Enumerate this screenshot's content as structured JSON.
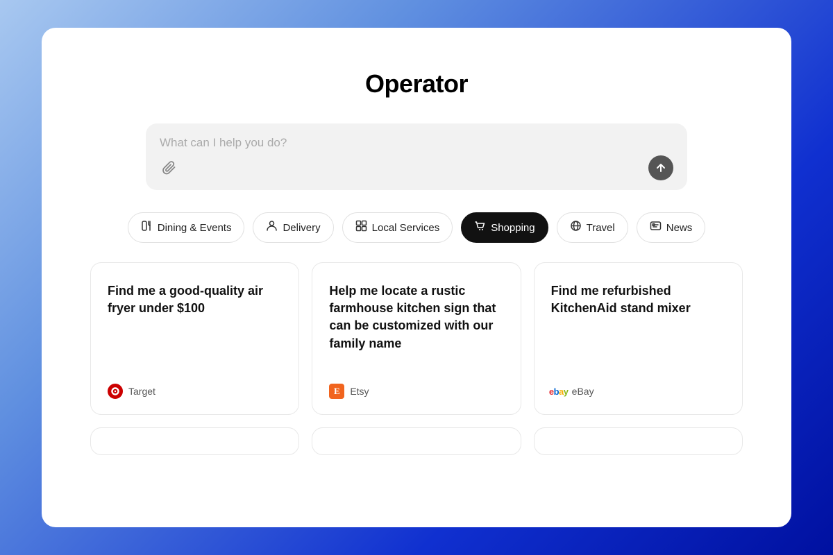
{
  "app": {
    "title": "Operator"
  },
  "search": {
    "placeholder": "What can I help you do?"
  },
  "categories": [
    {
      "id": "dining",
      "label": "Dining & Events",
      "icon": "🛍",
      "active": false
    },
    {
      "id": "delivery",
      "label": "Delivery",
      "icon": "🛵",
      "active": false
    },
    {
      "id": "local",
      "label": "Local Services",
      "icon": "🖥",
      "active": false
    },
    {
      "id": "shopping",
      "label": "Shopping",
      "icon": "🛍",
      "active": true
    },
    {
      "id": "travel",
      "label": "Travel",
      "icon": "🌐",
      "active": false
    },
    {
      "id": "news",
      "label": "News",
      "icon": "📰",
      "active": false
    }
  ],
  "cards": [
    {
      "id": "card1",
      "text": "Find me a good-quality air fryer under $100",
      "store": "Target",
      "store_type": "target"
    },
    {
      "id": "card2",
      "text": "Help me locate a rustic farmhouse kitchen sign that can be customized with our family name",
      "store": "Etsy",
      "store_type": "etsy"
    },
    {
      "id": "card3",
      "text": "Find me refurbished KitchenAid stand mixer",
      "store": "eBay",
      "store_type": "ebay"
    }
  ],
  "icons": {
    "attach": "📎",
    "submit_arrow": "↑",
    "dining_icon": "🫙",
    "delivery_icon": "👤",
    "local_icon": "⊞",
    "shopping_icon": "🛍",
    "travel_icon": "🌐",
    "news_icon": "📰"
  }
}
